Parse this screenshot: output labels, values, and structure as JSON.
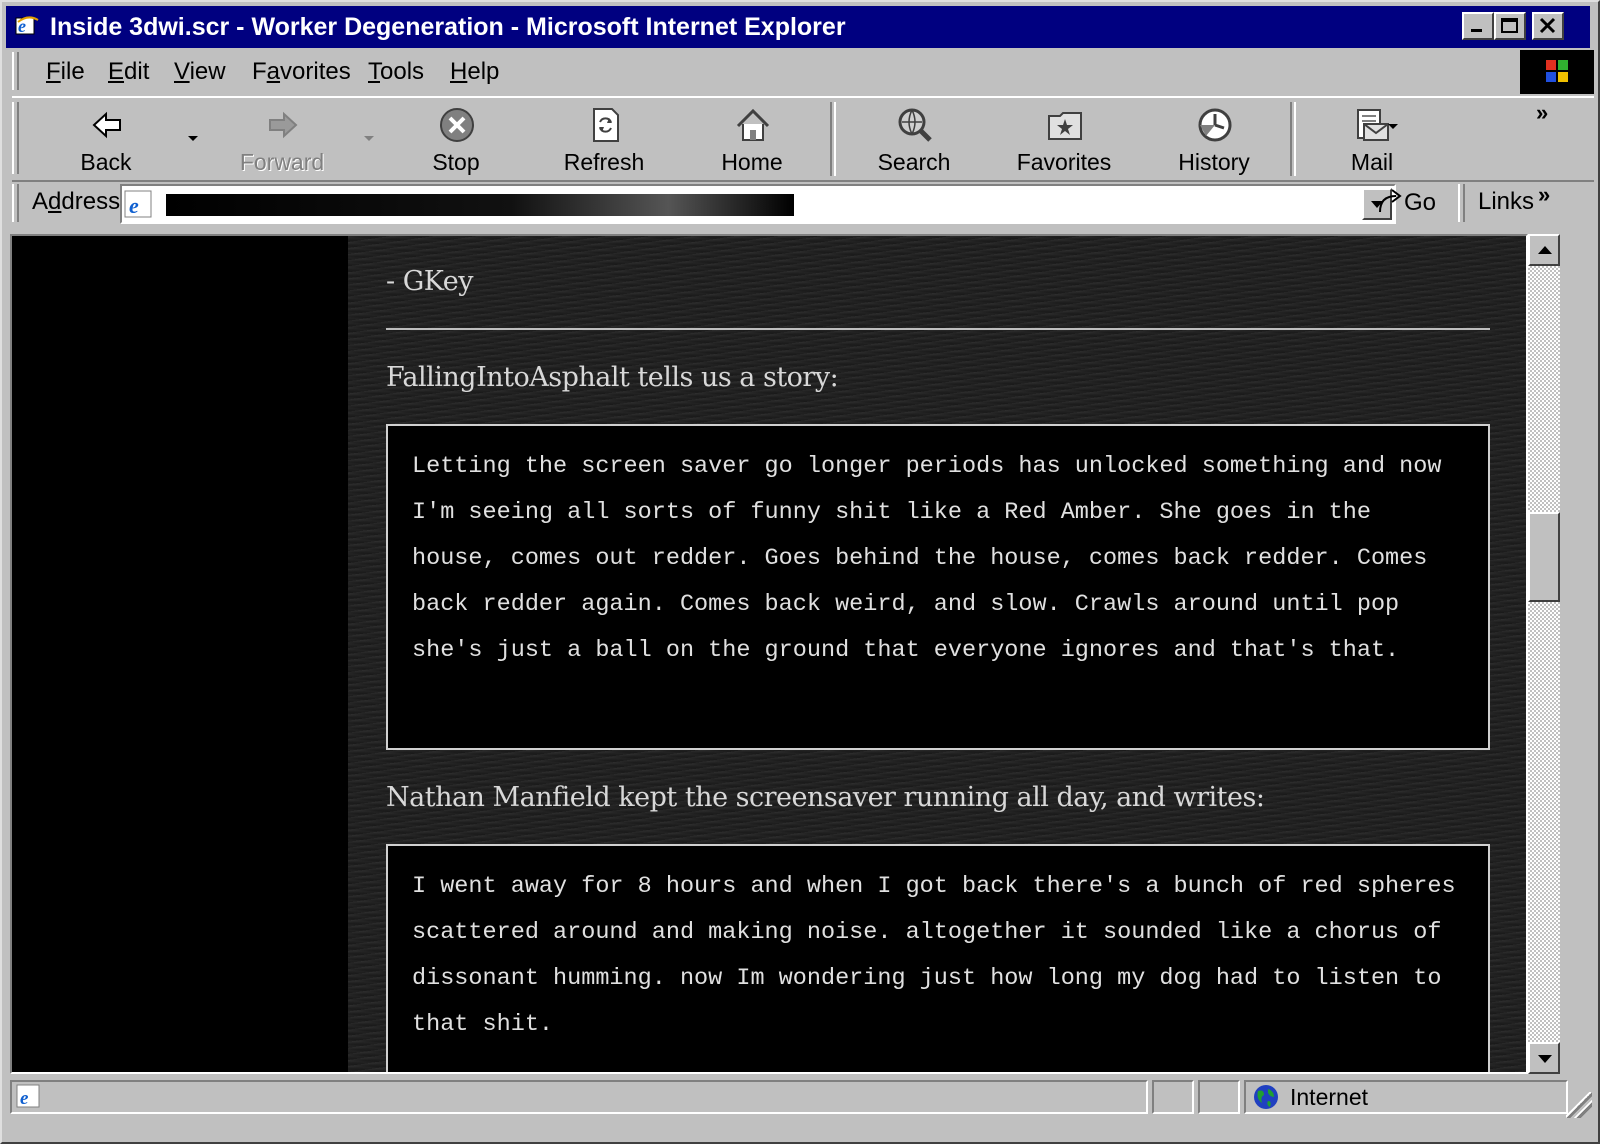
{
  "window": {
    "title": "Inside 3dwi.scr - Worker Degeneration - Microsoft Internet Explorer"
  },
  "menu": {
    "items": [
      {
        "label": "File",
        "key": "F",
        "rest": "ile"
      },
      {
        "label": "Edit",
        "key": "E",
        "rest": "dit"
      },
      {
        "label": "View",
        "key": "V",
        "rest": "iew"
      },
      {
        "label": "Favorites",
        "pre": "F",
        "key": "a",
        "rest": "vorites"
      },
      {
        "label": "Tools",
        "key": "T",
        "rest": "ools"
      },
      {
        "label": "Help",
        "key": "H",
        "rest": "elp"
      }
    ]
  },
  "toolbar": {
    "back": "Back",
    "forward": "Forward",
    "stop": "Stop",
    "refresh": "Refresh",
    "home": "Home",
    "search": "Search",
    "favorites": "Favorites",
    "history": "History",
    "mail": "Mail",
    "more": "»"
  },
  "address": {
    "label_pre": "A",
    "label_key": "d",
    "label_rest": "dress",
    "go": "Go",
    "links": "Links",
    "more": "»"
  },
  "page": {
    "signature": "- GKey",
    "story1_intro": "FallingIntoAsphalt tells us a story:",
    "story1_text": "Letting the screen saver go longer periods has unlocked something and now I'm seeing all sorts of funny shit like a Red Amber. She goes in the house, comes out redder. Goes behind the house, comes back redder. Comes back redder again. Comes back weird, and slow. Crawls around until pop she's just a ball on the ground that everyone ignores and that's that.",
    "story2_intro": "Nathan Manfield kept the screensaver running all day, and writes:",
    "story2_text": "I went away for 8 hours and when I got back there's a bunch of red spheres scattered around and making noise. altogether it sounded like a chorus of dissonant humming. now Im wondering just how long my dog had to listen to that shit."
  },
  "status": {
    "zone": "Internet"
  },
  "colors": {
    "titlebar": "#000080",
    "chrome": "#c0c0c0",
    "page_background": "#1c1c1c",
    "quote_background": "#000000"
  }
}
